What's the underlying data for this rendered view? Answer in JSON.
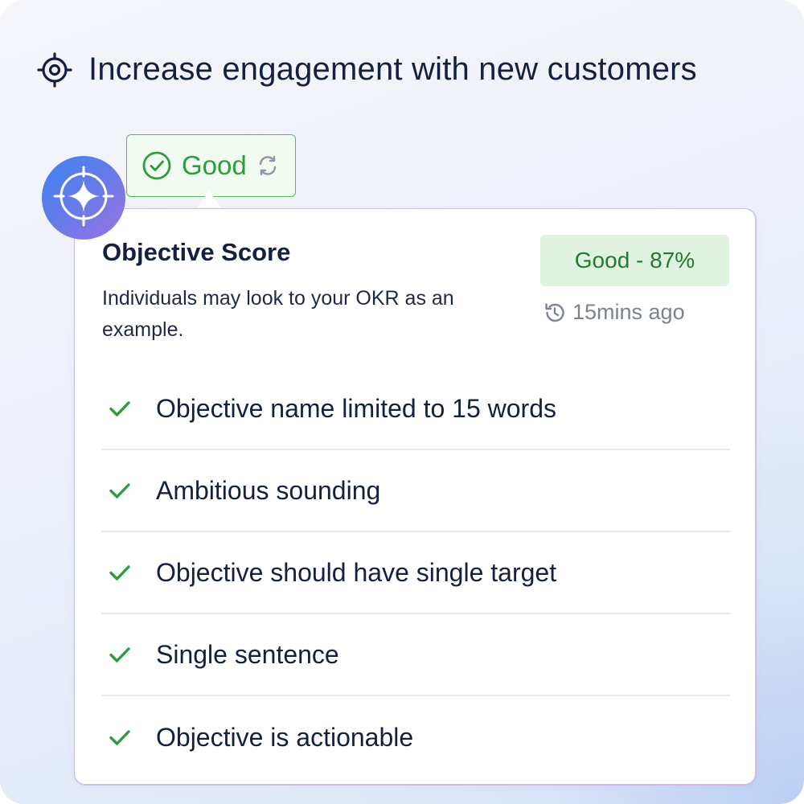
{
  "objective": {
    "title": "Increase engagement with new customers",
    "icon": "target-icon"
  },
  "status_chip": {
    "label": "Good",
    "icons": [
      "check-circle-icon",
      "refresh-icon"
    ]
  },
  "ai_badge": {
    "icon": "sparkle-icon"
  },
  "score_card": {
    "title": "Objective Score",
    "description": "Individuals may look to your OKR as an example.",
    "score_label": "Good - 87%",
    "updated": "15mins ago",
    "criteria": [
      {
        "text": "Objective name limited to 15 words",
        "passed": true
      },
      {
        "text": "Ambitious sounding",
        "passed": true
      },
      {
        "text": "Objective should have single target",
        "passed": true
      },
      {
        "text": "Single sentence",
        "passed": true
      },
      {
        "text": "Objective is actionable",
        "passed": true
      }
    ]
  },
  "colors": {
    "good_text": "#2e9c3e",
    "good_bg": "#dff3e0",
    "heading": "#13213f",
    "muted": "#7a8394"
  }
}
